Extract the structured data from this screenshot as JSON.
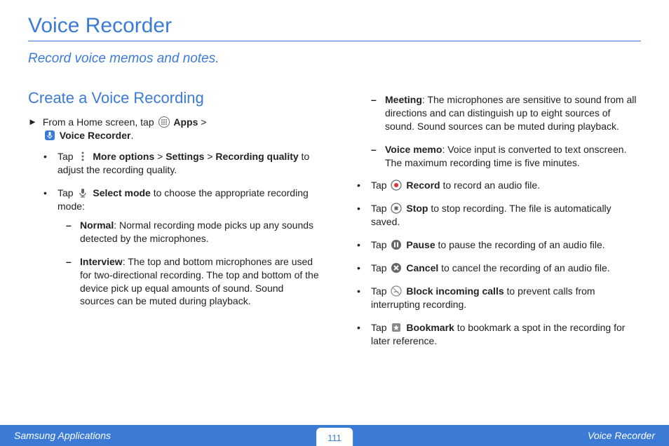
{
  "title": "Voice Recorder",
  "subtitle": "Record voice memos and notes.",
  "section_heading": "Create a Voice Recording",
  "step": {
    "prefix": "From a Home screen, tap ",
    "apps": "Apps",
    "gt": " > ",
    "vr": "Voice Recorder",
    "period": "."
  },
  "bul1": {
    "prefix": "Tap ",
    "more_options": "More options",
    "gt1": " > ",
    "settings": "Settings",
    "gt2": " > ",
    "rec_quality": "Recording quality",
    "suffix": " to adjust the recording quality."
  },
  "bul2": {
    "prefix": "Tap ",
    "select_mode": "Select mode",
    "suffix": " to choose the appropriate recording mode:"
  },
  "modes": {
    "normal": {
      "name": "Normal",
      "desc": ": Normal recording mode picks up any sounds detected by the microphones."
    },
    "interview": {
      "name": "Interview",
      "desc": ": The top and bottom microphones are used for two-directional recording. The top and bottom of the device pick up equal amounts of sound. Sound sources can be muted during playback."
    },
    "meeting": {
      "name": "Meeting",
      "desc": ": The microphones are sensitive to sound from all directions and can distinguish up to eight sources of sound. Sound sources can be muted during playback."
    },
    "voicememo": {
      "name": "Voice memo",
      "desc": ": Voice input is converted to text onscreen. The maximum recording time is five minutes."
    }
  },
  "actions": {
    "record": {
      "prefix": "Tap ",
      "name": "Record",
      "suffix": " to record an audio file."
    },
    "stop": {
      "prefix": "Tap ",
      "name": "Stop",
      "suffix": " to stop recording. The file is automatically saved."
    },
    "pause": {
      "prefix": "Tap ",
      "name": "Pause",
      "suffix": " to pause the recording of an audio file."
    },
    "cancel": {
      "prefix": "Tap ",
      "name": "Cancel",
      "suffix": " to cancel the recording of an audio file."
    },
    "block": {
      "prefix": "Tap ",
      "name": "Block incoming calls",
      "suffix": " to prevent calls from interrupting recording."
    },
    "bookmark": {
      "prefix": "Tap ",
      "name": "Bookmark",
      "suffix": " to bookmark a spot in the recording for later reference."
    }
  },
  "footer": {
    "left": "Samsung Applications",
    "page": "111",
    "right": "Voice Recorder"
  }
}
